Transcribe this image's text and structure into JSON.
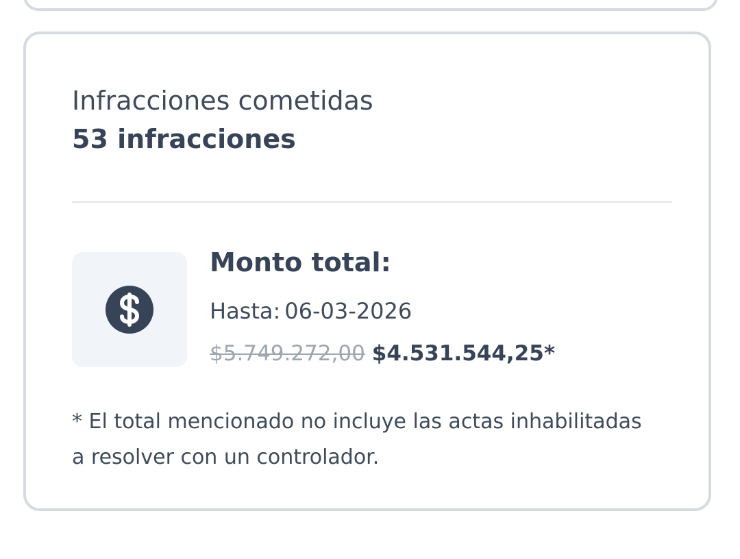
{
  "infracciones": {
    "label": "Infracciones cometidas",
    "count": "53 infracciones"
  },
  "monto": {
    "icon": "dollar-circle-icon",
    "title": "Monto total:",
    "hasta_label": "Hasta:",
    "hasta_date": "06-03-2026",
    "original_price": "$5.749.272,00",
    "discounted_price": "$4.531.544,25*"
  },
  "note": {
    "line1": "* El total mencionado no incluye las actas inhabilitadas",
    "line2": "a resolver con un controlador."
  },
  "colors": {
    "text_primary": "#374357",
    "card_border": "#d5dbe1",
    "icon_bg": "#f1f4f8",
    "strikethrough_text": "#9ea6b0"
  }
}
